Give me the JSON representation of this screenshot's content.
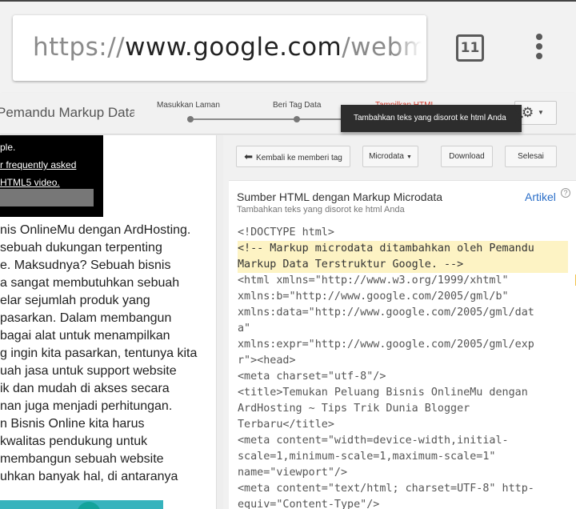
{
  "browser": {
    "url_scheme": "https://",
    "url_host": "www.google.com",
    "url_path": "/webmasters",
    "tab_count": "11",
    "menu_icon": "more-vert-icon"
  },
  "tagger": {
    "title": "Pemandu Markup Data Terstruktur",
    "steps": [
      {
        "label": "Masukkan Laman"
      },
      {
        "label": "Beri Tag Data"
      },
      {
        "label": "Tampilkan HTML"
      }
    ],
    "settings_icon": "gear-icon",
    "tooltip": "Tambahkan teks yang disorot ke html Anda"
  },
  "preview": {
    "video_lines": [
      "ple.",
      "r frequently asked",
      "HTML5 video."
    ],
    "article_lines": [
      "nis OnlineMu dengan ArdHosting.",
      "sebuah dukungan terpenting",
      "e. Maksudnya? Sebuah bisnis",
      "a sangat membutuhkan sebuah",
      "elar sejumlah produk yang",
      "pasarkan. Dalam membangun",
      "bagai alat untuk menampilkan",
      "g ingin kita pasarkan, tentunya kita",
      "uah jasa untuk support website",
      "ik dan mudah di akses secara",
      "nan juga menjadi perhitungan.",
      "n Bisnis Online kita harus",
      "kwalitas pendukung untuk",
      " membangun sebuah website",
      "uhkan banyak hal, di antaranya"
    ]
  },
  "toolbar": {
    "back_label": "Kembali ke memberi tag",
    "format_label": "Microdata",
    "download_label": "Download",
    "finish_label": "Selesai"
  },
  "source": {
    "title": "Sumber HTML dengan Markup Microdata",
    "subtitle": "Tambahkan teks yang disorot ke html Anda",
    "artikel_label": "Artikel",
    "help_label": "?",
    "code_lines": [
      {
        "text": "<!DOCTYPE html>",
        "highlight": false
      },
      {
        "text": "<!-- Markup microdata ditambahkan oleh Pemandu",
        "highlight": true
      },
      {
        "text": "Markup Data Terstruktur Google. -->",
        "highlight": true
      },
      {
        "text": "<html xmlns=\"http://www.w3.org/1999/xhtml\"",
        "highlight": false
      },
      {
        "text": "xmlns:b=\"http://www.google.com/2005/gml/b\"",
        "highlight": false
      },
      {
        "text": "xmlns:data=\"http://www.google.com/2005/gml/dat",
        "highlight": false
      },
      {
        "text": "a\"",
        "highlight": false
      },
      {
        "text": "xmlns:expr=\"http://www.google.com/2005/gml/exp",
        "highlight": false
      },
      {
        "text": "r\"><head>",
        "highlight": false
      },
      {
        "text": "<meta charset=\"utf-8\"/>",
        "highlight": false
      },
      {
        "text": "<title>Temukan Peluang Bisnis OnlineMu dengan",
        "highlight": false
      },
      {
        "text": "ArdHosting ~ Tips Trik Dunia Blogger",
        "highlight": false
      },
      {
        "text": "Terbaru</title>",
        "highlight": false
      },
      {
        "text": "<meta content=\"width=device-width,initial-",
        "highlight": false
      },
      {
        "text": "scale=1,minimum-scale=1,maximum-scale=1\"",
        "highlight": false
      },
      {
        "text": "name=\"viewport\"/>",
        "highlight": false
      },
      {
        "text": "<meta content=\"text/html; charset=UTF-8\" http-",
        "highlight": false
      },
      {
        "text": "equiv=\"Content-Type\"/>",
        "highlight": false
      }
    ]
  }
}
